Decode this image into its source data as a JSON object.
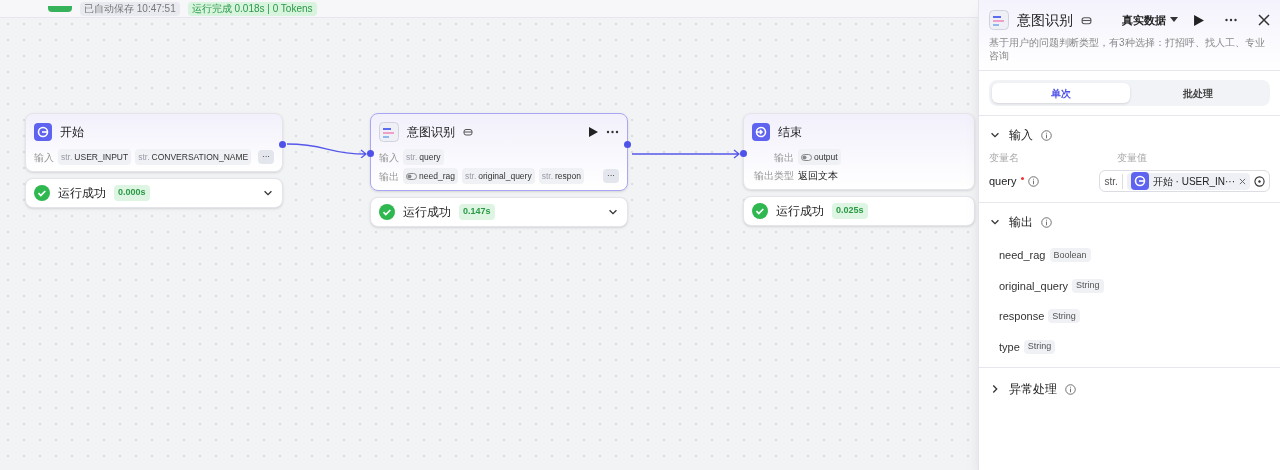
{
  "top_bar": {
    "save_status": "已自动保存 10:47:51",
    "run_status": "运行完成 0.018s | 0 Tokens"
  },
  "nodes": [
    {
      "kind": "start",
      "title": "开始",
      "selected": false,
      "rows": [
        {
          "label": "输入",
          "chips": [
            {
              "kind": "text",
              "type": "str.",
              "name": "USER_INPUT"
            },
            {
              "kind": "text",
              "type": "str.",
              "name": "CONVERSATION_NAME"
            }
          ],
          "more": "···"
        }
      ],
      "status": "运行成功",
      "time": "0.000s",
      "expandable": true
    },
    {
      "kind": "llm",
      "title": "意图识别",
      "selected": true,
      "rows": [
        {
          "label": "输入",
          "chips": [
            {
              "kind": "text",
              "type": "str.",
              "name": "query"
            }
          ]
        },
        {
          "label": "输出",
          "chips": [
            {
              "kind": "toggle",
              "name": "need_rag"
            },
            {
              "kind": "text",
              "type": "str.",
              "name": "original_query"
            },
            {
              "kind": "text",
              "type": "str.",
              "name": "respon"
            }
          ],
          "more": "···"
        }
      ],
      "status": "运行成功",
      "time": "0.147s",
      "expandable": true
    },
    {
      "kind": "end",
      "title": "结束",
      "selected": false,
      "rows": [
        {
          "label": "输出",
          "chips": [
            {
              "kind": "toggle",
              "name": "output"
            }
          ]
        },
        {
          "label": "输出类型",
          "text": "返回文本"
        }
      ],
      "status": "运行成功",
      "time": "0.025s",
      "expandable": false
    }
  ],
  "panel": {
    "title": "意图识别",
    "data_mode": "真实数据",
    "description": "基于用户的问题判断类型，有3种选择：打招呼、找人工、专业咨询",
    "tabs": [
      {
        "label": "单次",
        "selected": true
      },
      {
        "label": "批处理",
        "selected": false
      }
    ],
    "input_section": {
      "title": "输入",
      "expanded": true,
      "col_name": "变量名",
      "col_value": "变量值",
      "variables": [
        {
          "name": "query",
          "required": true,
          "type": "str.",
          "source_node": "开始",
          "separator": "·",
          "source_var": "USER_IN···"
        }
      ]
    },
    "output_section": {
      "title": "输出",
      "expanded": true,
      "fields": [
        {
          "name": "need_rag",
          "type": "Boolean"
        },
        {
          "name": "original_query",
          "type": "String"
        },
        {
          "name": "response",
          "type": "String"
        },
        {
          "name": "type",
          "type": "String"
        }
      ]
    },
    "error_section": {
      "title": "异常处理",
      "expanded": false
    }
  }
}
